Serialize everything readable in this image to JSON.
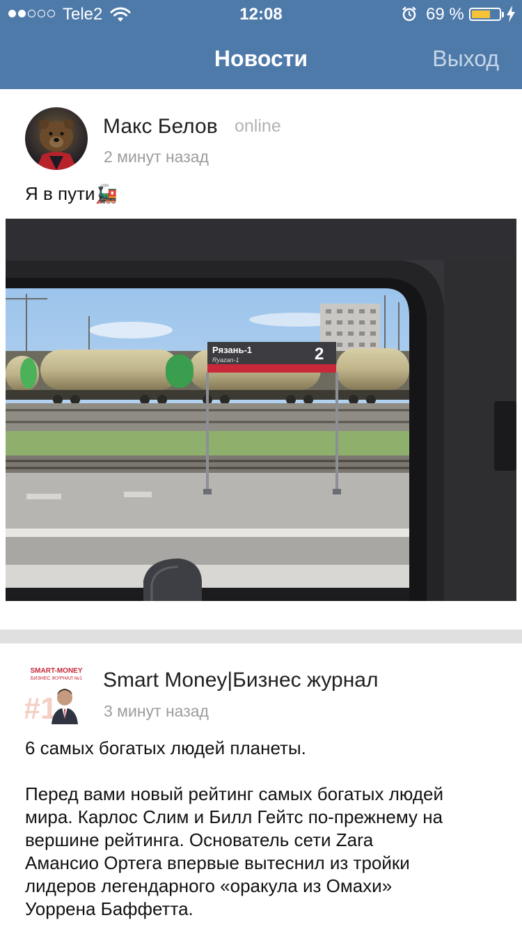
{
  "status_bar": {
    "carrier": "Tele2",
    "time": "12:08",
    "battery_percent": "69 %",
    "battery_level": 0.69,
    "signal_bars_filled": 2,
    "signal_bars_total": 5
  },
  "nav": {
    "title": "Новости",
    "exit_label": "Выход"
  },
  "posts": [
    {
      "author": "Макс Белов",
      "status": "online",
      "time": "2 минут назад",
      "text": "Я в пути🚂",
      "photo_sign": {
        "station": "Рязань-1",
        "station_latin": "Ryazan-1",
        "platform": "2"
      }
    },
    {
      "author": "Smart Money|Бизнес журнал",
      "time": "3 минут назад",
      "avatar_logo_line1": "SMART-MONEY",
      "avatar_logo_line2": "БИЗНЕС ЖУРНАЛ №1",
      "avatar_badge": "#1",
      "headline": "6 самых богатых людей планеты.",
      "body": "Перед вами новый рейтинг самых богатых людей\nмира. Карлос Слим и Билл Гейтс по-прежнему на\nвершине рейтинга. Основатель сети Zara\nАмансио Ортега впервые вытеснил из тройки\nлидеров легендарного «оракула из Омахи»\nУоррена Баффетта."
    }
  ],
  "colors": {
    "nav_background": "#4e7aaa",
    "exit_text": "#c6d6e8",
    "battery": "#f6c338",
    "divider": "#e0e0e0",
    "secondary_text": "#9c9c9c"
  }
}
